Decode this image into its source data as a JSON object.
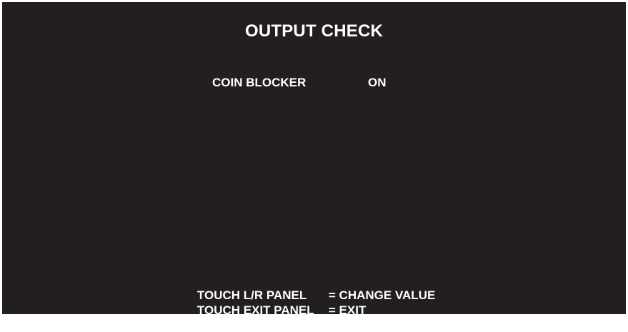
{
  "screen": {
    "title": "OUTPUT CHECK"
  },
  "setting": {
    "label": "COIN BLOCKER",
    "value": "ON"
  },
  "help": [
    {
      "key": "TOUCH L/R PANEL",
      "action": "= CHANGE VALUE"
    },
    {
      "key": "TOUCH EXIT PANEL",
      "action": "= EXIT"
    }
  ],
  "colors": {
    "background": "#231f20",
    "text": "#ffffff"
  }
}
